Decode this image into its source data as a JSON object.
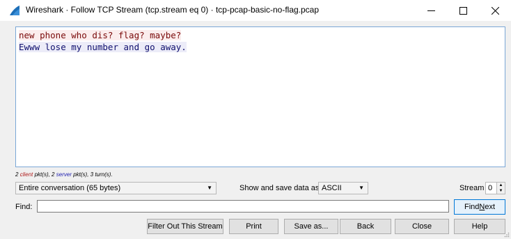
{
  "window": {
    "title": "Wireshark · Follow TCP Stream (tcp.stream eq 0) · tcp-pcap-basic-no-flag.pcap"
  },
  "stream": {
    "line1_client": "new phone who dis? flag? maybe?",
    "line2_server": "Ewww lose my number and go away."
  },
  "stats": {
    "client_count": "2",
    "client_word": "client",
    "mid": "pkt(s), 2",
    "server_word": "server",
    "tail": "pkt(s), 3 turn(s)."
  },
  "conversation": {
    "selected": "Entire conversation (65 bytes)"
  },
  "show_save": {
    "label": "Show and save data as",
    "format": "ASCII"
  },
  "stream_selector": {
    "label": "Stream",
    "value": "0"
  },
  "find": {
    "label": "Find:",
    "value": "",
    "next_label_pre": "Find ",
    "next_label_u": "N",
    "next_label_post": "ext"
  },
  "buttons": {
    "filter_out": "Filter Out This Stream",
    "print": "Print",
    "save_as": "Save as...",
    "back": "Back",
    "close": "Close",
    "help": "Help"
  },
  "colors": {
    "client_text": "#7a0a0a",
    "client_bg": "#fbeded",
    "server_text": "#0f0f6e",
    "server_bg": "#ececf8"
  }
}
